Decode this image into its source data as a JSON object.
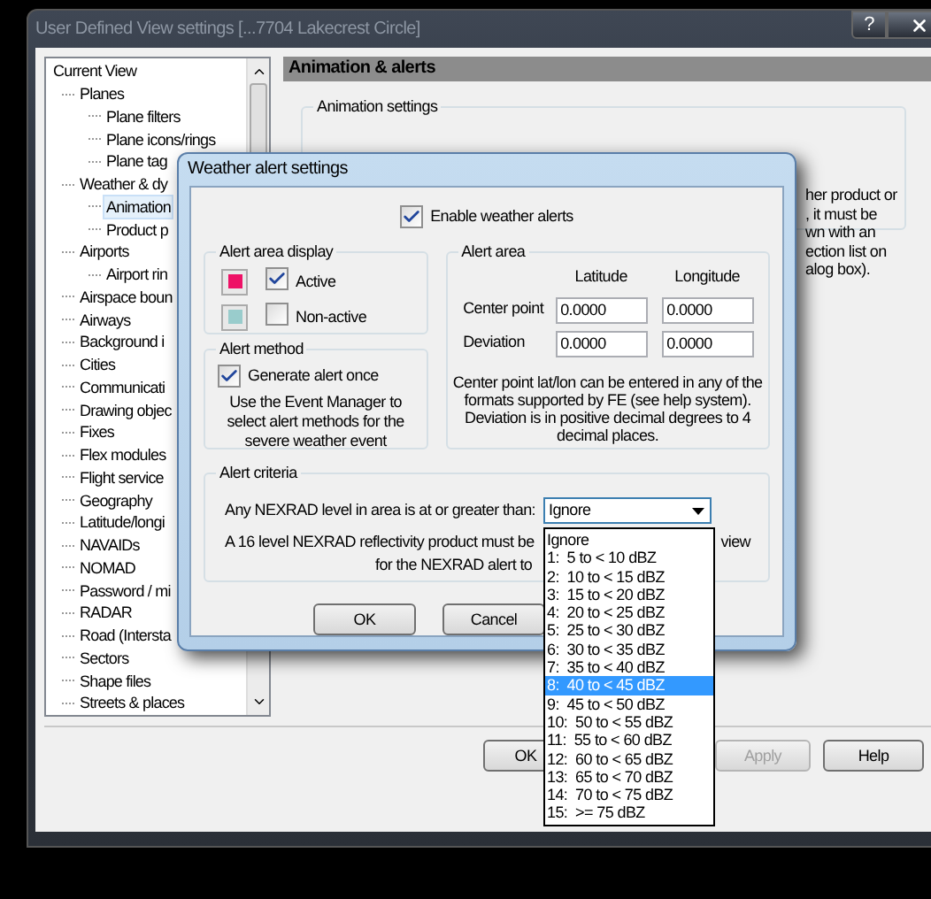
{
  "main_window": {
    "title": "User Defined View settings  [...7704 Lakecrest Circle]",
    "help_button": "?"
  },
  "tree": {
    "items": [
      {
        "label": "Current View",
        "selected": false,
        "children": [
          {
            "label": "Planes",
            "selected": false,
            "children": [
              {
                "label": "Plane filters",
                "selected": false
              },
              {
                "label": "Plane icons/rings",
                "selected": false
              },
              {
                "label": "Plane tag",
                "selected": false
              }
            ]
          },
          {
            "label": "Weather & dy",
            "selected": false,
            "children": [
              {
                "label": "Animation",
                "selected": true
              },
              {
                "label": "Product p",
                "selected": false
              }
            ]
          },
          {
            "label": "Airports",
            "selected": false,
            "children": [
              {
                "label": "Airport rin",
                "selected": false
              }
            ]
          },
          {
            "label": "Airspace boun",
            "selected": false
          },
          {
            "label": "Airways",
            "selected": false
          },
          {
            "label": "Background i",
            "selected": false
          },
          {
            "label": "Cities",
            "selected": false
          },
          {
            "label": "Communicati",
            "selected": false
          },
          {
            "label": "Drawing objec",
            "selected": false
          },
          {
            "label": "Fixes",
            "selected": false
          },
          {
            "label": "Flex modules",
            "selected": false
          },
          {
            "label": "Flight service",
            "selected": false
          },
          {
            "label": "Geography",
            "selected": false
          },
          {
            "label": "Latitude/longi",
            "selected": false
          },
          {
            "label": "NAVAIDs",
            "selected": false
          },
          {
            "label": "NOMAD",
            "selected": false
          },
          {
            "label": "Password / mi",
            "selected": false
          },
          {
            "label": "RADAR",
            "selected": false
          },
          {
            "label": "Road (Intersta",
            "selected": false
          },
          {
            "label": "Sectors",
            "selected": false
          },
          {
            "label": "Shape files",
            "selected": false
          },
          {
            "label": "Streets & places",
            "selected": false
          }
        ]
      }
    ]
  },
  "panel": {
    "header": "Animation & alerts",
    "group_label": "Animation settings",
    "note_lines": [
      "her product or",
      ", it must be",
      "wn with an",
      "ection list on",
      "alog box)."
    ]
  },
  "footer_buttons": [
    {
      "label": "OK",
      "disabled": false
    },
    {
      "label": "Apply",
      "disabled": true
    },
    {
      "label": "Help",
      "disabled": false
    }
  ],
  "dialog": {
    "title": "Weather alert settings",
    "enable": {
      "label": "Enable weather alerts",
      "checked": true
    },
    "area_display": {
      "label": "Alert area display",
      "rows": [
        {
          "color": "#ee1166",
          "label": "Active",
          "checked": true
        },
        {
          "color": "#99cccc",
          "label": "Non-active",
          "checked": false
        }
      ]
    },
    "method": {
      "label": "Alert method",
      "option": {
        "label": "Generate alert once",
        "checked": true
      },
      "note": "Use the Event Manager to select alert methods for the severe weather event"
    },
    "area": {
      "label": "Alert area",
      "columns": [
        "Latitude",
        "Longitude"
      ],
      "rows": [
        {
          "label": "Center point",
          "values": [
            "0.0000",
            "0.0000"
          ]
        },
        {
          "label": "Deviation",
          "values": [
            "0.0000",
            "0.0000"
          ]
        }
      ],
      "note": "Center point lat/lon can be entered in any of the formats supported by FE (see help system). Deviation is in positive decimal degrees to 4 decimal places."
    },
    "criteria": {
      "label": "Alert criteria",
      "prompt": "Any NEXRAD level in area is at or greater than:",
      "select_value": "Ignore",
      "note_line_1": "A 16 level NEXRAD reflectivity product must be",
      "note_line_1_end": "view",
      "note_line_2": "for the NEXRAD alert to"
    },
    "buttons": [
      "OK",
      "Cancel"
    ]
  },
  "dropdown": {
    "options": [
      {
        "label": "Ignore",
        "selected": false
      },
      {
        "label": "1:  5 to < 10 dBZ",
        "selected": false
      },
      {
        "label": "2:  10 to < 15 dBZ",
        "selected": false
      },
      {
        "label": "3:  15 to < 20 dBZ",
        "selected": false
      },
      {
        "label": "4:  20 to < 25 dBZ",
        "selected": false
      },
      {
        "label": "5:  25 to < 30 dBZ",
        "selected": false
      },
      {
        "label": "6:  30 to < 35 dBZ",
        "selected": false
      },
      {
        "label": "7:  35 to < 40 dBZ",
        "selected": false
      },
      {
        "label": "8:  40 to < 45 dBZ",
        "selected": true
      },
      {
        "label": "9:  45 to < 50 dBZ",
        "selected": false
      },
      {
        "label": "10:  50 to < 55 dBZ",
        "selected": false
      },
      {
        "label": "11:  55 to < 60 dBZ",
        "selected": false
      },
      {
        "label": "12:  60 to < 65 dBZ",
        "selected": false
      },
      {
        "label": "13:  65 to < 70 dBZ",
        "selected": false
      },
      {
        "label": "14:  70 to < 75 dBZ",
        "selected": false
      },
      {
        "label": "15:  >= 75 dBZ",
        "selected": false
      }
    ]
  }
}
